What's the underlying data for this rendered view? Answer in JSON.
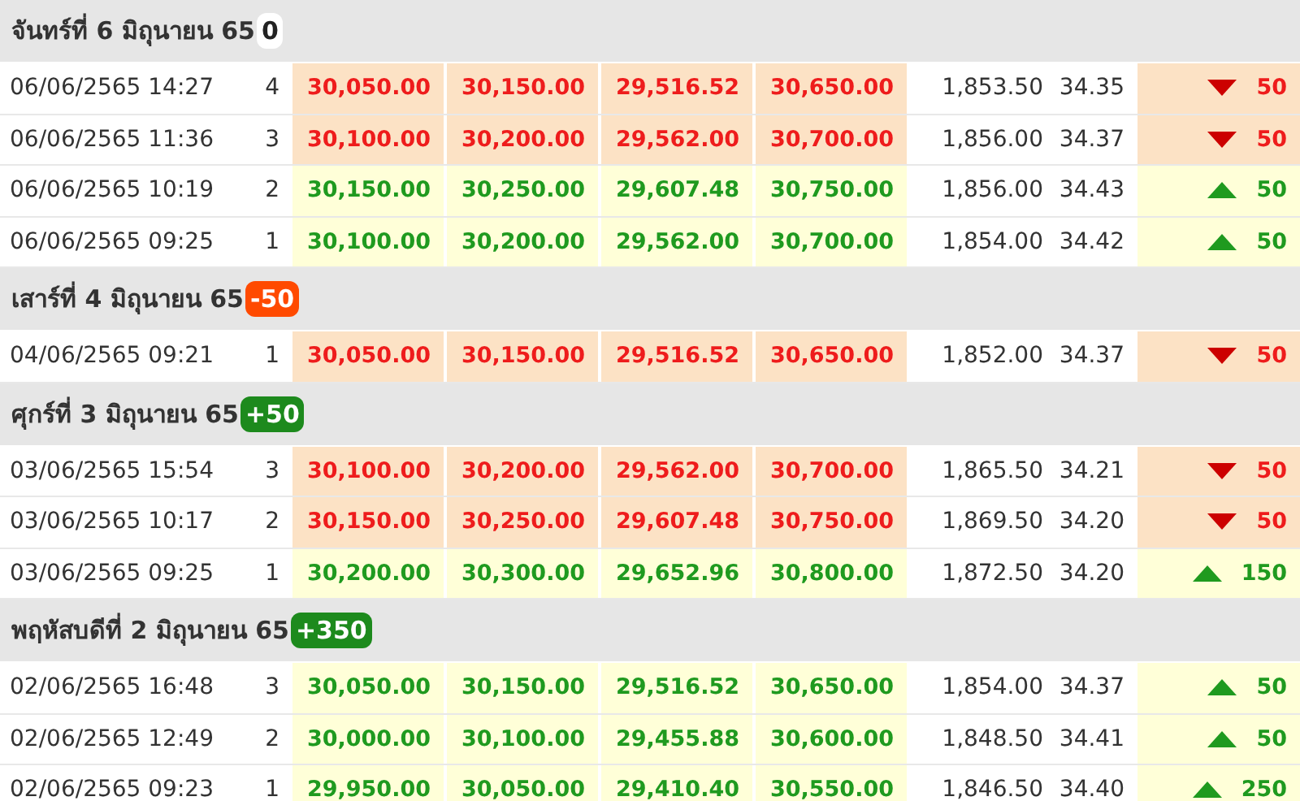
{
  "groups": [
    {
      "date": "จันทร์ที่ 6 มิถุนายน 65",
      "badge": {
        "text": "0",
        "kind": "flat"
      },
      "rows": [
        {
          "time": "06/06/2565 14:27",
          "round": "4",
          "prices": [
            "30,050.00",
            "30,150.00",
            "29,516.52",
            "30,650.00"
          ],
          "gold": "1,853.50",
          "rate": "34.35",
          "change": "50",
          "kind": "down"
        },
        {
          "time": "06/06/2565 11:36",
          "round": "3",
          "prices": [
            "30,100.00",
            "30,200.00",
            "29,562.00",
            "30,700.00"
          ],
          "gold": "1,856.00",
          "rate": "34.37",
          "change": "50",
          "kind": "down"
        },
        {
          "time": "06/06/2565 10:19",
          "round": "2",
          "prices": [
            "30,150.00",
            "30,250.00",
            "29,607.48",
            "30,750.00"
          ],
          "gold": "1,856.00",
          "rate": "34.43",
          "change": "50",
          "kind": "up"
        },
        {
          "time": "06/06/2565 09:25",
          "round": "1",
          "prices": [
            "30,100.00",
            "30,200.00",
            "29,562.00",
            "30,700.00"
          ],
          "gold": "1,854.00",
          "rate": "34.42",
          "change": "50",
          "kind": "up"
        }
      ]
    },
    {
      "date": "เสาร์ที่ 4 มิถุนายน 65",
      "badge": {
        "text": "-50",
        "kind": "down"
      },
      "rows": [
        {
          "time": "04/06/2565 09:21",
          "round": "1",
          "prices": [
            "30,050.00",
            "30,150.00",
            "29,516.52",
            "30,650.00"
          ],
          "gold": "1,852.00",
          "rate": "34.37",
          "change": "50",
          "kind": "down"
        }
      ]
    },
    {
      "date": "ศุกร์ที่ 3 มิถุนายน 65",
      "badge": {
        "text": "+50",
        "kind": "up"
      },
      "rows": [
        {
          "time": "03/06/2565 15:54",
          "round": "3",
          "prices": [
            "30,100.00",
            "30,200.00",
            "29,562.00",
            "30,700.00"
          ],
          "gold": "1,865.50",
          "rate": "34.21",
          "change": "50",
          "kind": "down"
        },
        {
          "time": "03/06/2565 10:17",
          "round": "2",
          "prices": [
            "30,150.00",
            "30,250.00",
            "29,607.48",
            "30,750.00"
          ],
          "gold": "1,869.50",
          "rate": "34.20",
          "change": "50",
          "kind": "down"
        },
        {
          "time": "03/06/2565 09:25",
          "round": "1",
          "prices": [
            "30,200.00",
            "30,300.00",
            "29,652.96",
            "30,800.00"
          ],
          "gold": "1,872.50",
          "rate": "34.20",
          "change": "150",
          "kind": "up"
        }
      ]
    },
    {
      "date": "พฤหัสบดีที่ 2 มิถุนายน 65",
      "badge": {
        "text": "+350",
        "kind": "up"
      },
      "rows": [
        {
          "time": "02/06/2565 16:48",
          "round": "3",
          "prices": [
            "30,050.00",
            "30,150.00",
            "29,516.52",
            "30,650.00"
          ],
          "gold": "1,854.00",
          "rate": "34.37",
          "change": "50",
          "kind": "up"
        },
        {
          "time": "02/06/2565 12:49",
          "round": "2",
          "prices": [
            "30,000.00",
            "30,100.00",
            "29,455.88",
            "30,600.00"
          ],
          "gold": "1,848.50",
          "rate": "34.41",
          "change": "50",
          "kind": "up"
        },
        {
          "time": "02/06/2565 09:23",
          "round": "1",
          "prices": [
            "29,950.00",
            "30,050.00",
            "29,410.40",
            "30,550.00"
          ],
          "gold": "1,846.50",
          "rate": "34.40",
          "change": "250",
          "kind": "up"
        }
      ]
    }
  ]
}
